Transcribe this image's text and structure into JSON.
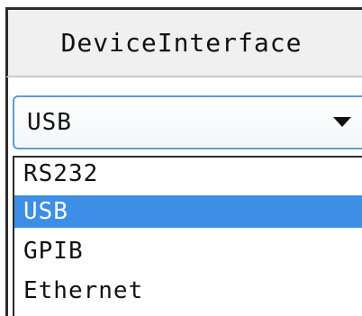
{
  "header": {
    "label": "DeviceInterface"
  },
  "select": {
    "value": "USB"
  },
  "dropdown": {
    "options": [
      {
        "label": "RS232",
        "selected": false
      },
      {
        "label": "USB",
        "selected": true
      },
      {
        "label": "GPIB",
        "selected": false
      },
      {
        "label": "Ethernet",
        "selected": false
      }
    ]
  },
  "colors": {
    "selection": "#3d8ee6",
    "focus_border": "#5f9bd3"
  },
  "icons": {
    "dropdown_arrow": "chevron-down-icon"
  }
}
